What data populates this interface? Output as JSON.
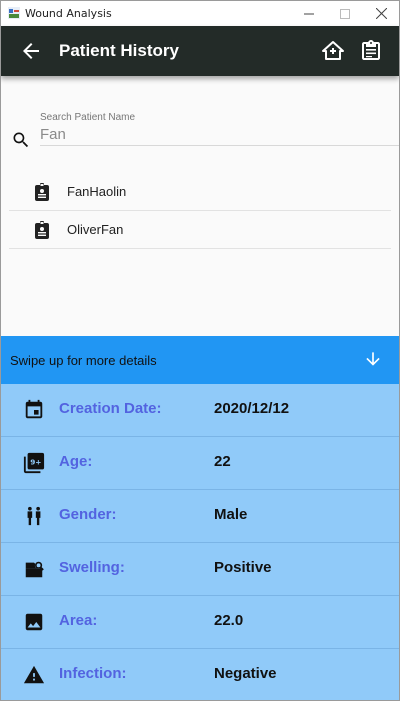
{
  "window": {
    "title": "Wound Analysis"
  },
  "appbar": {
    "title": "Patient History"
  },
  "search": {
    "label": "Search Patient Name",
    "value": "Fan"
  },
  "results": [
    {
      "name": "FanHaolin"
    },
    {
      "name": "OliverFan"
    }
  ],
  "sheet": {
    "hint": "Swipe up for more details"
  },
  "details": [
    {
      "icon": "calendar-icon",
      "label": "Creation Date:",
      "value": "2020/12/12"
    },
    {
      "icon": "age-icon",
      "label": "Age:",
      "value": "22"
    },
    {
      "icon": "gender-icon",
      "label": "Gender:",
      "value": "Male"
    },
    {
      "icon": "swelling-icon",
      "label": "Swelling:",
      "value": "Positive"
    },
    {
      "icon": "image-icon",
      "label": "Area:",
      "value": "22.0"
    },
    {
      "icon": "warning-icon",
      "label": "Infection:",
      "value": "Negative"
    }
  ],
  "colors": {
    "appbar": "#232b28",
    "sheet_header": "#2196f3",
    "details_bg": "#90caf9",
    "label": "#5363e0"
  }
}
